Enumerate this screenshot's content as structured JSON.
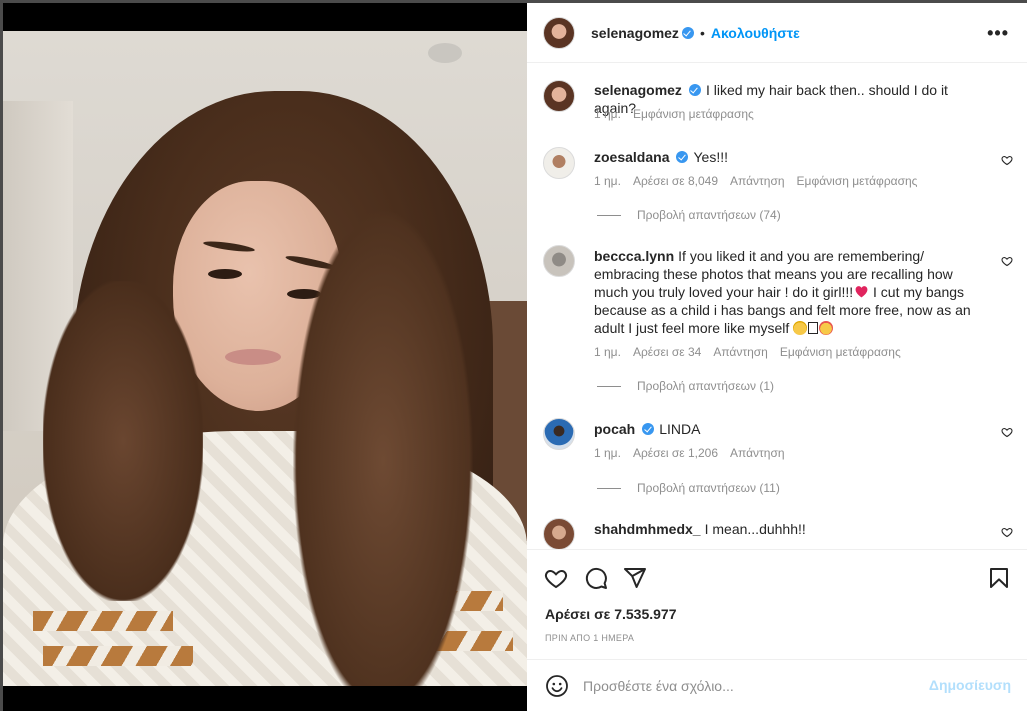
{
  "post": {
    "author": "selenagomez",
    "follow_label": "Ακολουθήστε",
    "more_icon": "more-horizontal-icon",
    "separator": "•"
  },
  "caption": {
    "username": "selenagomez",
    "text": "I liked my hair back then.. should I do it again?",
    "time": "1 ημ.",
    "translate": "Εμφάνιση μετάφρασης"
  },
  "comments": [
    {
      "username": "zoesaldana",
      "verified": true,
      "text": "Yes!!!",
      "time": "1 ημ.",
      "likes": "Αρέσει σε 8,049",
      "reply": "Απάντηση",
      "translate": "Εμφάνιση μετάφρασης",
      "view_replies": "Προβολή απαντήσεων (74)"
    },
    {
      "username": "beccca.lynn",
      "verified": false,
      "text": "If you liked it and you are remembering/ embracing these photos that means you are recalling how much you truly loved your hair ! do it girl!!!",
      "text_after_heart": " I cut my bangs because as a child i has bangs and felt more free, now as an adult I just feel more like myself",
      "time": "1 ημ.",
      "likes": "Αρέσει σε 34",
      "reply": "Απάντηση",
      "translate": "Εμφάνιση μετάφρασης",
      "view_replies": "Προβολή απαντήσεων (1)"
    },
    {
      "username": "pocah",
      "verified": true,
      "text": "LINDA",
      "time": "1 ημ.",
      "likes": "Αρέσει σε 1,206",
      "reply": "Απάντηση",
      "view_replies": "Προβολή απαντήσεων (11)"
    },
    {
      "username": "shahdmhmedx_",
      "verified": false,
      "text": "I mean...duhhh!!"
    }
  ],
  "actions": {
    "like_icon": "heart-icon",
    "comment_icon": "comment-icon",
    "share_icon": "send-icon",
    "save_icon": "bookmark-icon",
    "likes_text": "Αρέσει σε 7.535.977",
    "timestamp": "ΠΡΙΝ ΑΠΟ 1 ΗΜΕΡΑ"
  },
  "add_comment": {
    "emoji_icon": "smiley-icon",
    "placeholder": "Προσθέστε ένα σχόλιο...",
    "post_label": "Δημοσίευση"
  },
  "colors": {
    "link_blue": "#0095f6",
    "verified_blue": "#3897f0",
    "muted_text": "#8e8e8e",
    "disabled_post": "#b2dffc"
  }
}
